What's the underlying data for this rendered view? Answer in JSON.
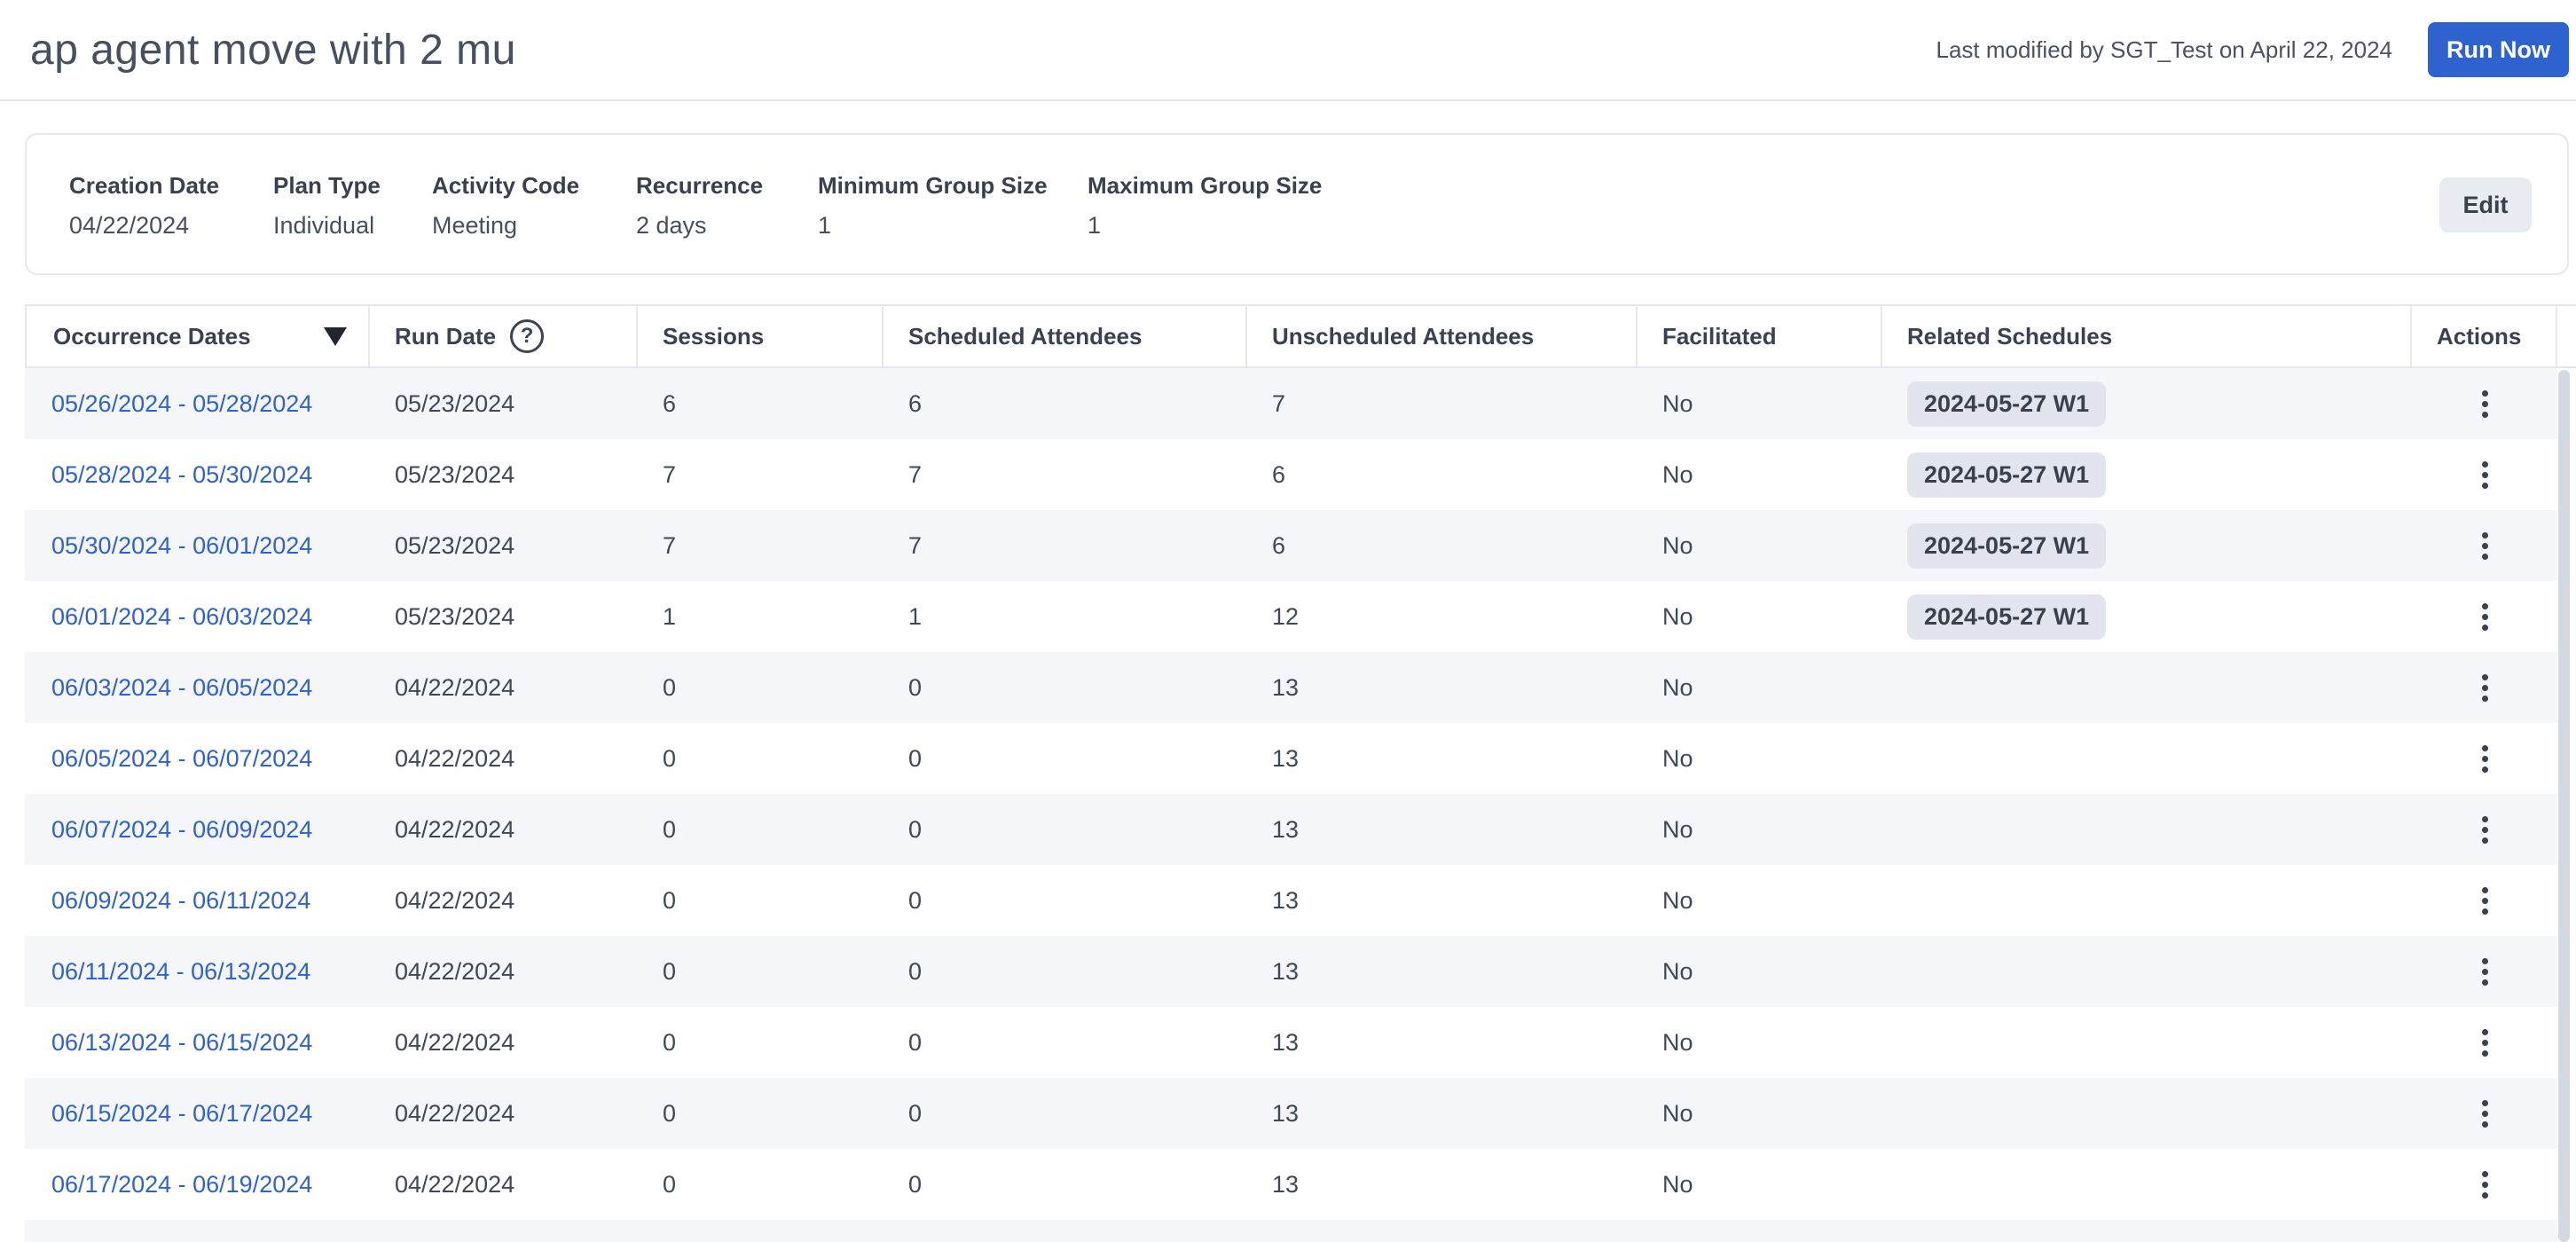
{
  "topbar": {
    "title": "ap agent move with 2 mu",
    "last_modified": "Last modified by SGT_Test on April 22, 2024",
    "run_now_label": "Run Now"
  },
  "summary": {
    "edit_label": "Edit",
    "fields": [
      {
        "label": "Creation Date",
        "value": "04/22/2024"
      },
      {
        "label": "Plan Type",
        "value": "Individual"
      },
      {
        "label": "Activity Code",
        "value": "Meeting"
      },
      {
        "label": "Recurrence",
        "value": "2 days"
      },
      {
        "label": "Minimum Group Size",
        "value": "1"
      },
      {
        "label": "Maximum Group Size",
        "value": "1"
      }
    ]
  },
  "table": {
    "columns": [
      {
        "label": "Occurrence Dates",
        "icon": "sort-descending-icon"
      },
      {
        "label": "Run Date",
        "icon": "help-circle-icon"
      },
      {
        "label": "Sessions"
      },
      {
        "label": "Scheduled Attendees"
      },
      {
        "label": "Unscheduled Attendees"
      },
      {
        "label": "Facilitated"
      },
      {
        "label": "Related Schedules"
      },
      {
        "label": "Actions"
      }
    ],
    "rows": [
      {
        "occurrence_dates": "05/26/2024 - 05/28/2024",
        "run_date": "05/23/2024",
        "sessions": "6",
        "scheduled_attendees": "6",
        "unscheduled_attendees": "7",
        "facilitated": "No",
        "related_schedule": "2024-05-27 W1"
      },
      {
        "occurrence_dates": "05/28/2024 - 05/30/2024",
        "run_date": "05/23/2024",
        "sessions": "7",
        "scheduled_attendees": "7",
        "unscheduled_attendees": "6",
        "facilitated": "No",
        "related_schedule": "2024-05-27 W1"
      },
      {
        "occurrence_dates": "05/30/2024 - 06/01/2024",
        "run_date": "05/23/2024",
        "sessions": "7",
        "scheduled_attendees": "7",
        "unscheduled_attendees": "6",
        "facilitated": "No",
        "related_schedule": "2024-05-27 W1"
      },
      {
        "occurrence_dates": "06/01/2024 - 06/03/2024",
        "run_date": "05/23/2024",
        "sessions": "1",
        "scheduled_attendees": "1",
        "unscheduled_attendees": "12",
        "facilitated": "No",
        "related_schedule": "2024-05-27 W1"
      },
      {
        "occurrence_dates": "06/03/2024 - 06/05/2024",
        "run_date": "04/22/2024",
        "sessions": "0",
        "scheduled_attendees": "0",
        "unscheduled_attendees": "13",
        "facilitated": "No",
        "related_schedule": ""
      },
      {
        "occurrence_dates": "06/05/2024 - 06/07/2024",
        "run_date": "04/22/2024",
        "sessions": "0",
        "scheduled_attendees": "0",
        "unscheduled_attendees": "13",
        "facilitated": "No",
        "related_schedule": ""
      },
      {
        "occurrence_dates": "06/07/2024 - 06/09/2024",
        "run_date": "04/22/2024",
        "sessions": "0",
        "scheduled_attendees": "0",
        "unscheduled_attendees": "13",
        "facilitated": "No",
        "related_schedule": ""
      },
      {
        "occurrence_dates": "06/09/2024 - 06/11/2024",
        "run_date": "04/22/2024",
        "sessions": "0",
        "scheduled_attendees": "0",
        "unscheduled_attendees": "13",
        "facilitated": "No",
        "related_schedule": ""
      },
      {
        "occurrence_dates": "06/11/2024 - 06/13/2024",
        "run_date": "04/22/2024",
        "sessions": "0",
        "scheduled_attendees": "0",
        "unscheduled_attendees": "13",
        "facilitated": "No",
        "related_schedule": ""
      },
      {
        "occurrence_dates": "06/13/2024 - 06/15/2024",
        "run_date": "04/22/2024",
        "sessions": "0",
        "scheduled_attendees": "0",
        "unscheduled_attendees": "13",
        "facilitated": "No",
        "related_schedule": ""
      },
      {
        "occurrence_dates": "06/15/2024 - 06/17/2024",
        "run_date": "04/22/2024",
        "sessions": "0",
        "scheduled_attendees": "0",
        "unscheduled_attendees": "13",
        "facilitated": "No",
        "related_schedule": ""
      },
      {
        "occurrence_dates": "06/17/2024 - 06/19/2024",
        "run_date": "04/22/2024",
        "sessions": "0",
        "scheduled_attendees": "0",
        "unscheduled_attendees": "13",
        "facilitated": "No",
        "related_schedule": ""
      }
    ]
  },
  "icons": {
    "help_glyph": "?"
  },
  "colors": {
    "accent_blue": "#2e63cf",
    "link_blue": "#2f62cd",
    "badge_bg": "#e2e5ee",
    "alt_row_bg": "#f5f6f9"
  }
}
